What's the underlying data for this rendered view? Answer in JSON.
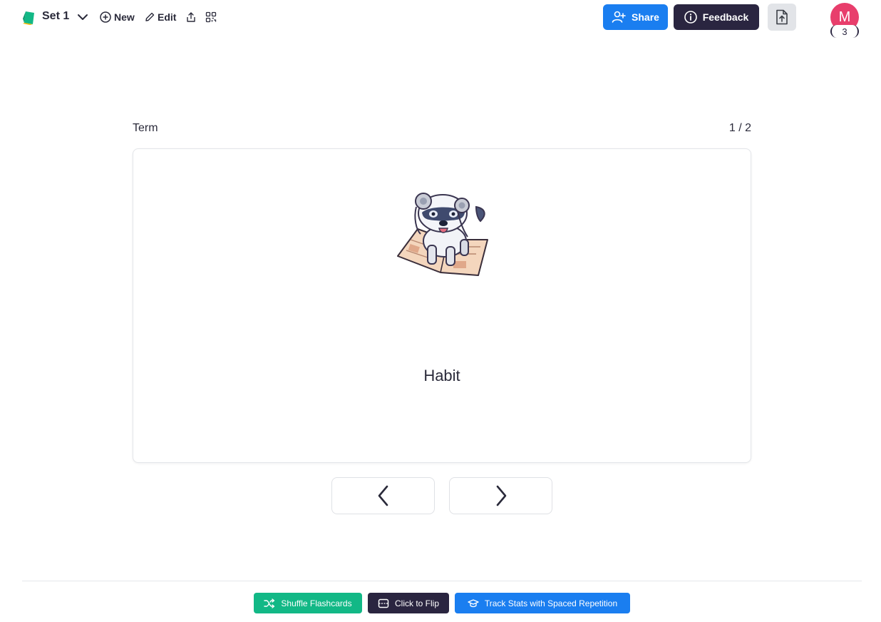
{
  "header": {
    "set_title": "Set 1",
    "tools": {
      "new_label": "New",
      "edit_label": "Edit"
    },
    "share_label": "Share",
    "feedback_label": "Feedback",
    "avatar_initial": "M",
    "avatar_badge": "3",
    "colors": {
      "share": "#1a7ef0",
      "feedback": "#2a2540",
      "avatar": "#e83e6c"
    }
  },
  "flashcard": {
    "side_label": "Term",
    "position": "1 / 2",
    "term": "Habit",
    "image": "robot-dog-on-newspaper"
  },
  "footer": {
    "shuffle_label": "Shuffle Flashcards",
    "flip_label": "Click to Flip",
    "track_label": "Track Stats with Spaced Repetition",
    "colors": {
      "shuffle": "#12b886",
      "flip": "#2a2540",
      "track": "#1a7ef0"
    }
  }
}
